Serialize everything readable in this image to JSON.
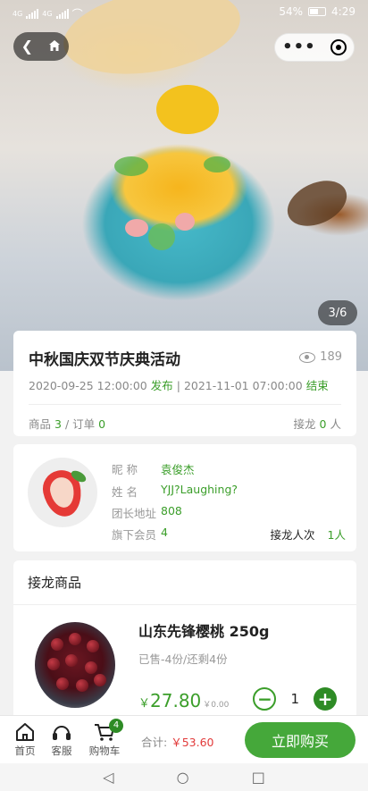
{
  "status_bar": {
    "signal_left": "4G",
    "signal_right": "4G",
    "battery": "54%",
    "time": "4:29"
  },
  "nav": {
    "back_icon": "chevron-left-icon",
    "home_icon": "home-icon",
    "more_icon": "more-dots-icon",
    "target_icon": "target-icon"
  },
  "hero": {
    "counter": "3/6"
  },
  "event": {
    "title": "中秋国庆双节庆典活动",
    "views": "189",
    "start_date": "2020-09-25 12:00:00",
    "start_label": "发布",
    "separator": "|",
    "end_date": "2021-11-01 07:00:00",
    "end_label": "结束",
    "products_label": "商品",
    "products_count": "3",
    "orders_label": "订单",
    "orders_count": "0",
    "relay_label": "接龙",
    "relay_count": "0",
    "relay_unit": "人"
  },
  "leader": {
    "nickname_label": "昵 称",
    "nickname": "袁俊杰",
    "name_label": "姓 名",
    "name": "YJJ?Laughing?",
    "address_label": "团长地址",
    "address": "808",
    "members_label": "旗下会员",
    "members": "4",
    "relay_times_label": "接龙人次",
    "relay_times": "1人"
  },
  "products": {
    "header": "接龙商品",
    "items": [
      {
        "name": "山东先锋樱桃 250g",
        "sold": "已售-4份/还剩4份",
        "currency": "￥",
        "price": "27.80",
        "orig_price": "￥0.00",
        "quantity": "1"
      }
    ]
  },
  "bottom": {
    "tabs": [
      {
        "label": "首页",
        "icon": "home-icon"
      },
      {
        "label": "客服",
        "icon": "headset-icon"
      },
      {
        "label": "购物车",
        "icon": "cart-icon",
        "badge": "4"
      }
    ],
    "total_label": "合计:",
    "total_amount": "￥53.60",
    "buy_label": "立即购买"
  },
  "colors": {
    "accent": "#45a83a",
    "price": "#3b9e2a",
    "total": "#e23b3b"
  }
}
